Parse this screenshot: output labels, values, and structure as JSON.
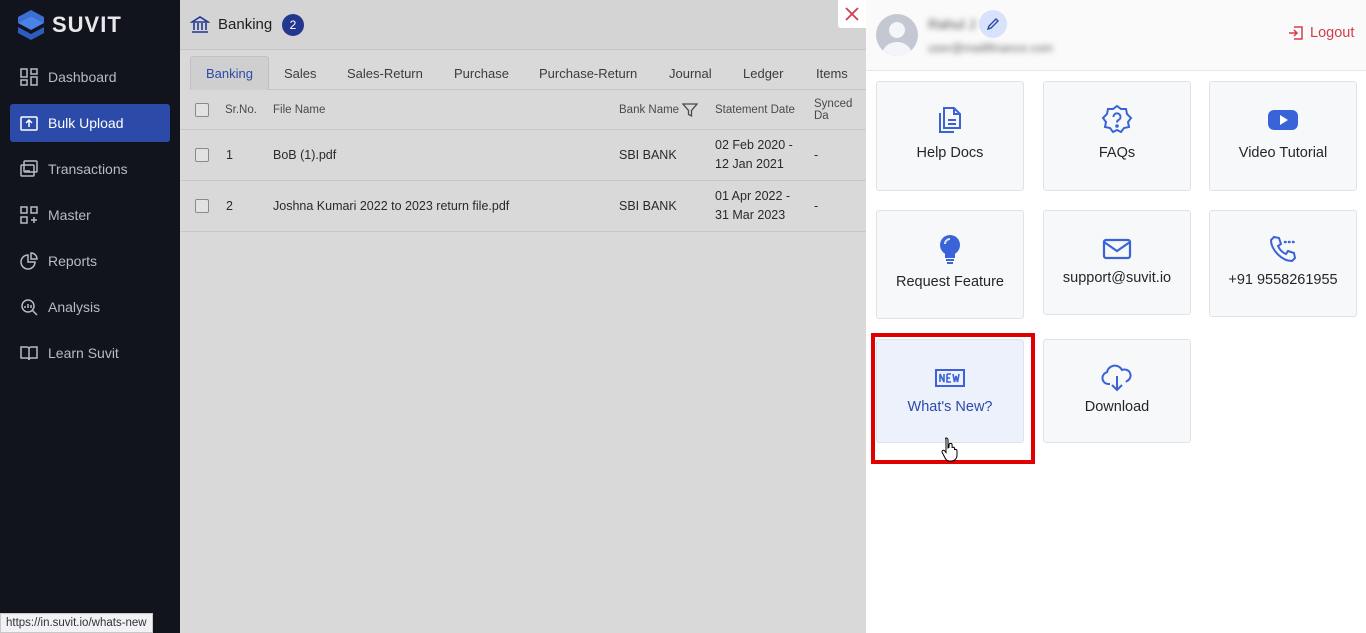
{
  "sidebar": {
    "brand": "SUVIT",
    "items": [
      {
        "label": "Dashboard"
      },
      {
        "label": "Bulk Upload"
      },
      {
        "label": "Transactions"
      },
      {
        "label": "Master"
      },
      {
        "label": "Reports"
      },
      {
        "label": "Analysis"
      },
      {
        "label": "Learn Suvit"
      }
    ]
  },
  "header": {
    "title": "Banking",
    "count": "2"
  },
  "tabs": [
    "Banking",
    "Sales",
    "Sales-Return",
    "Purchase",
    "Purchase-Return",
    "Journal",
    "Ledger",
    "Items"
  ],
  "table": {
    "columns": {
      "srno": "Sr.No.",
      "file": "File Name",
      "bank": "Bank Name",
      "date": "Statement Date",
      "synced": "Synced Da"
    },
    "rows": [
      {
        "srno": "1",
        "file": "BoB (1).pdf",
        "bank": "SBI BANK",
        "date_from": "02 Feb 2020 -",
        "date_to": "12 Jan 2021",
        "synced": "-"
      },
      {
        "srno": "2",
        "file": "Joshna Kumari 2022 to 2023 return file.pdf",
        "bank": "SBI BANK",
        "date_from": "01 Apr 2022 -",
        "date_to": "31 Mar 2023",
        "synced": "-"
      }
    ]
  },
  "status_url": "https://in.suvit.io/whats-new",
  "panel": {
    "user": {
      "name": "Rahul J",
      "email": "user@maillfinance.com"
    },
    "logout_label": "Logout",
    "cards": [
      {
        "label": "Help Docs",
        "icon": "docs-icon"
      },
      {
        "label": "FAQs",
        "icon": "question-badge-icon"
      },
      {
        "label": "Video Tutorial",
        "icon": "youtube-icon"
      },
      {
        "label": "Request Feature",
        "icon": "lightbulb-icon"
      },
      {
        "label": "support@suvit.io",
        "icon": "mail-icon"
      },
      {
        "label": "+91 9558261955",
        "icon": "phone-icon"
      },
      {
        "label": "What's New?",
        "icon": "new-badge-icon"
      },
      {
        "label": "Download",
        "icon": "cloud-download-icon"
      }
    ]
  },
  "colors": {
    "accent": "#2c4aa8",
    "sidebar_bg": "#12141d",
    "logout": "#d43d49",
    "highlight_box": "#e00000"
  }
}
